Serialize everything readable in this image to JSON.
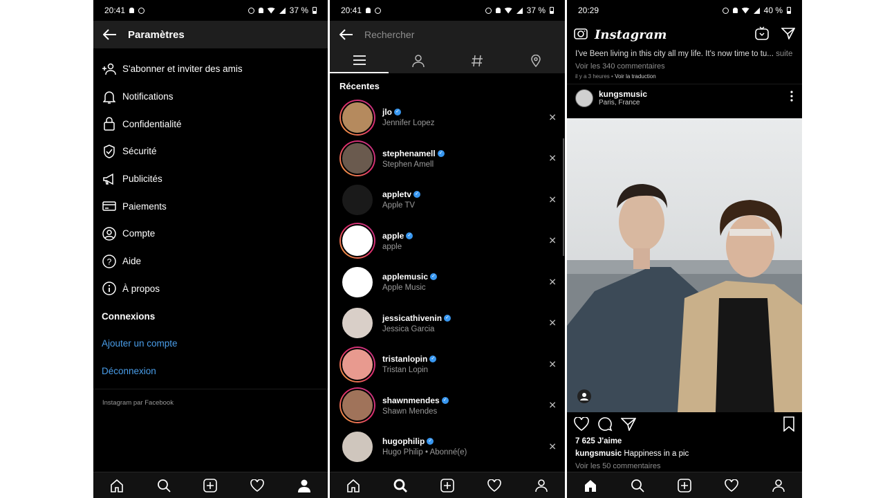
{
  "screen1": {
    "status": {
      "time": "20:41",
      "battery": "37 %"
    },
    "title": "Paramètres",
    "items": [
      {
        "label": "S'abonner et inviter des amis",
        "icon": "add-person-icon"
      },
      {
        "label": "Notifications",
        "icon": "bell-icon"
      },
      {
        "label": "Confidentialité",
        "icon": "lock-icon"
      },
      {
        "label": "Sécurité",
        "icon": "shield-icon"
      },
      {
        "label": "Publicités",
        "icon": "megaphone-icon"
      },
      {
        "label": "Paiements",
        "icon": "card-icon"
      },
      {
        "label": "Compte",
        "icon": "person-circle-icon"
      },
      {
        "label": "Aide",
        "icon": "help-icon"
      },
      {
        "label": "À propos",
        "icon": "info-icon"
      }
    ],
    "section": "Connexions",
    "add_account": "Ajouter un compte",
    "logout": "Déconnexion",
    "footer": "Instagram par Facebook"
  },
  "screen2": {
    "status": {
      "time": "20:41",
      "battery": "37 %"
    },
    "search_placeholder": "Rechercher",
    "recent_label": "Récentes",
    "accounts": [
      {
        "username": "jlo",
        "name": "Jennifer Lopez",
        "ring": true,
        "bg": "#b58a5e"
      },
      {
        "username": "stephenamell",
        "name": "Stephen Amell",
        "ring": true,
        "bg": "#6a5a4e"
      },
      {
        "username": "appletv",
        "name": "Apple TV",
        "ring": false,
        "bg": "#1a1a1a"
      },
      {
        "username": "apple",
        "name": "apple",
        "ring": true,
        "bg": "#ffffff"
      },
      {
        "username": "applemusic",
        "name": "Apple Music",
        "ring": false,
        "bg": "#ffffff"
      },
      {
        "username": "jessicathivenin",
        "name": "Jessica Garcia",
        "ring": false,
        "bg": "#d9cfc8"
      },
      {
        "username": "tristanlopin",
        "name": "Tristan Lopin",
        "ring": true,
        "bg": "#e89a8f"
      },
      {
        "username": "shawnmendes",
        "name": "Shawn Mendes",
        "ring": true,
        "bg": "#a0735a"
      },
      {
        "username": "hugophilip",
        "name": "Hugo Philip • Abonné(e)",
        "ring": false,
        "bg": "#cfc6bd"
      }
    ]
  },
  "screen3": {
    "status": {
      "time": "20:29",
      "battery": "40 %"
    },
    "logo": "Instagram",
    "caption": "I've Been living in this city all my life. It's now time to tu...",
    "caption_more": "suite",
    "view_comments_top": "Voir les 340 commentaires",
    "time_ago": "il y a 3 heures",
    "translate": "Voir la traduction",
    "post_user": "kungsmusic",
    "post_location": "Paris, France",
    "likes": "7 625 J'aime",
    "post_caption_user": "kungsmusic",
    "post_caption_text": "Happiness in a pic",
    "view_comments": "Voir les 50 commentaires"
  },
  "colors": {
    "accent": "#4a9eea",
    "verified": "#3897f0",
    "bar": "#1e1e1e"
  }
}
